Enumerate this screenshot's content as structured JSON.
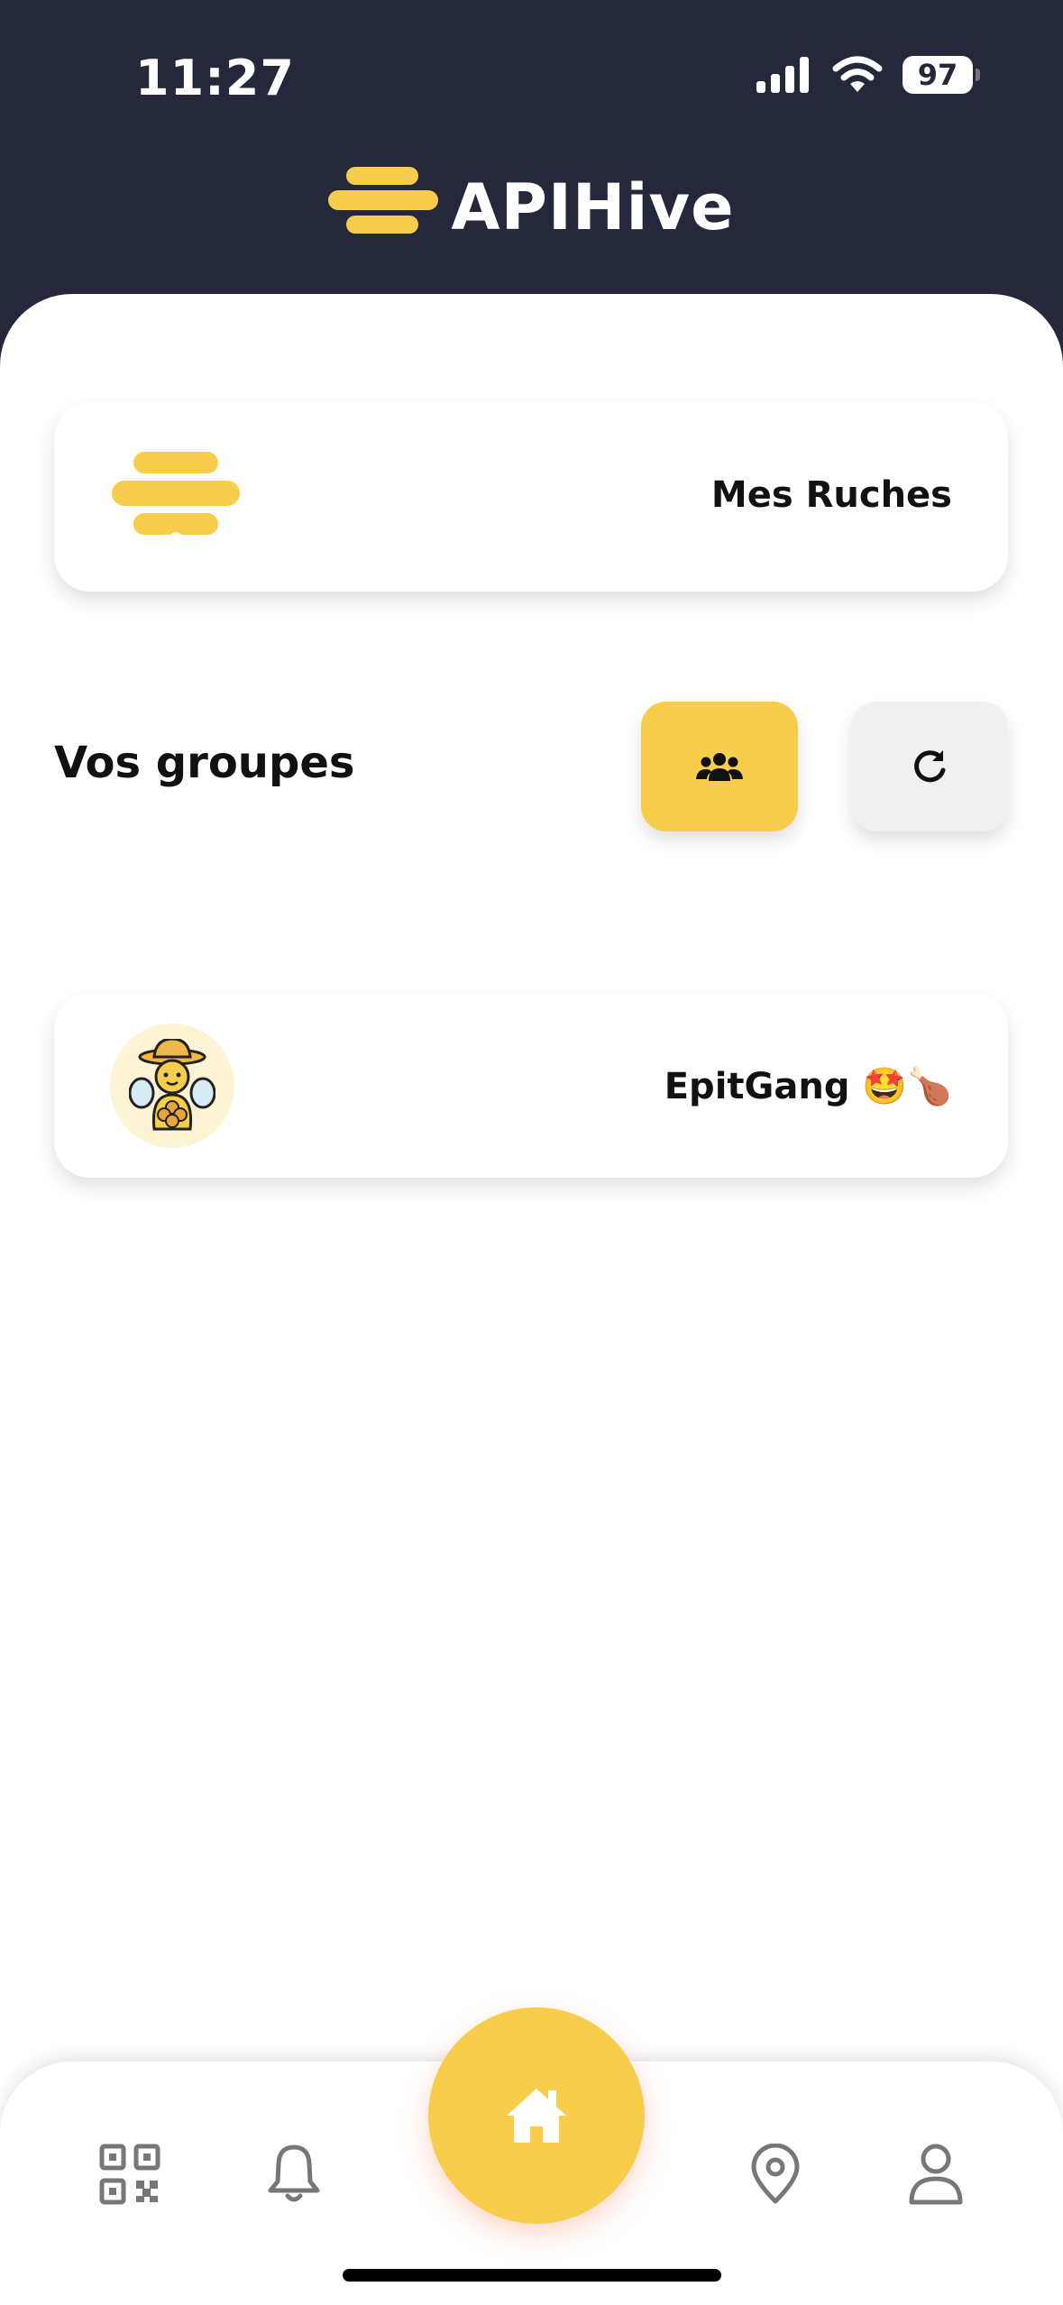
{
  "status_bar": {
    "time": "11:27",
    "battery": "97"
  },
  "header": {
    "app_title": "APIHive",
    "brand_color": "#f7cd4b"
  },
  "main": {
    "hives_card_label": "Mes Ruches",
    "groups_title": "Vos groupes",
    "groups": [
      {
        "name": "EpitGang 🤩🍗",
        "avatar": "beekeeper-icon"
      }
    ]
  },
  "bottom_nav": {
    "items": [
      "qr-code-icon",
      "bell-icon",
      "home-icon",
      "location-pin-icon",
      "user-icon"
    ],
    "active": "home-icon"
  },
  "colors": {
    "header_bg": "#25283a",
    "accent": "#f7cd4b",
    "secondary_button": "#f0f0f0"
  }
}
